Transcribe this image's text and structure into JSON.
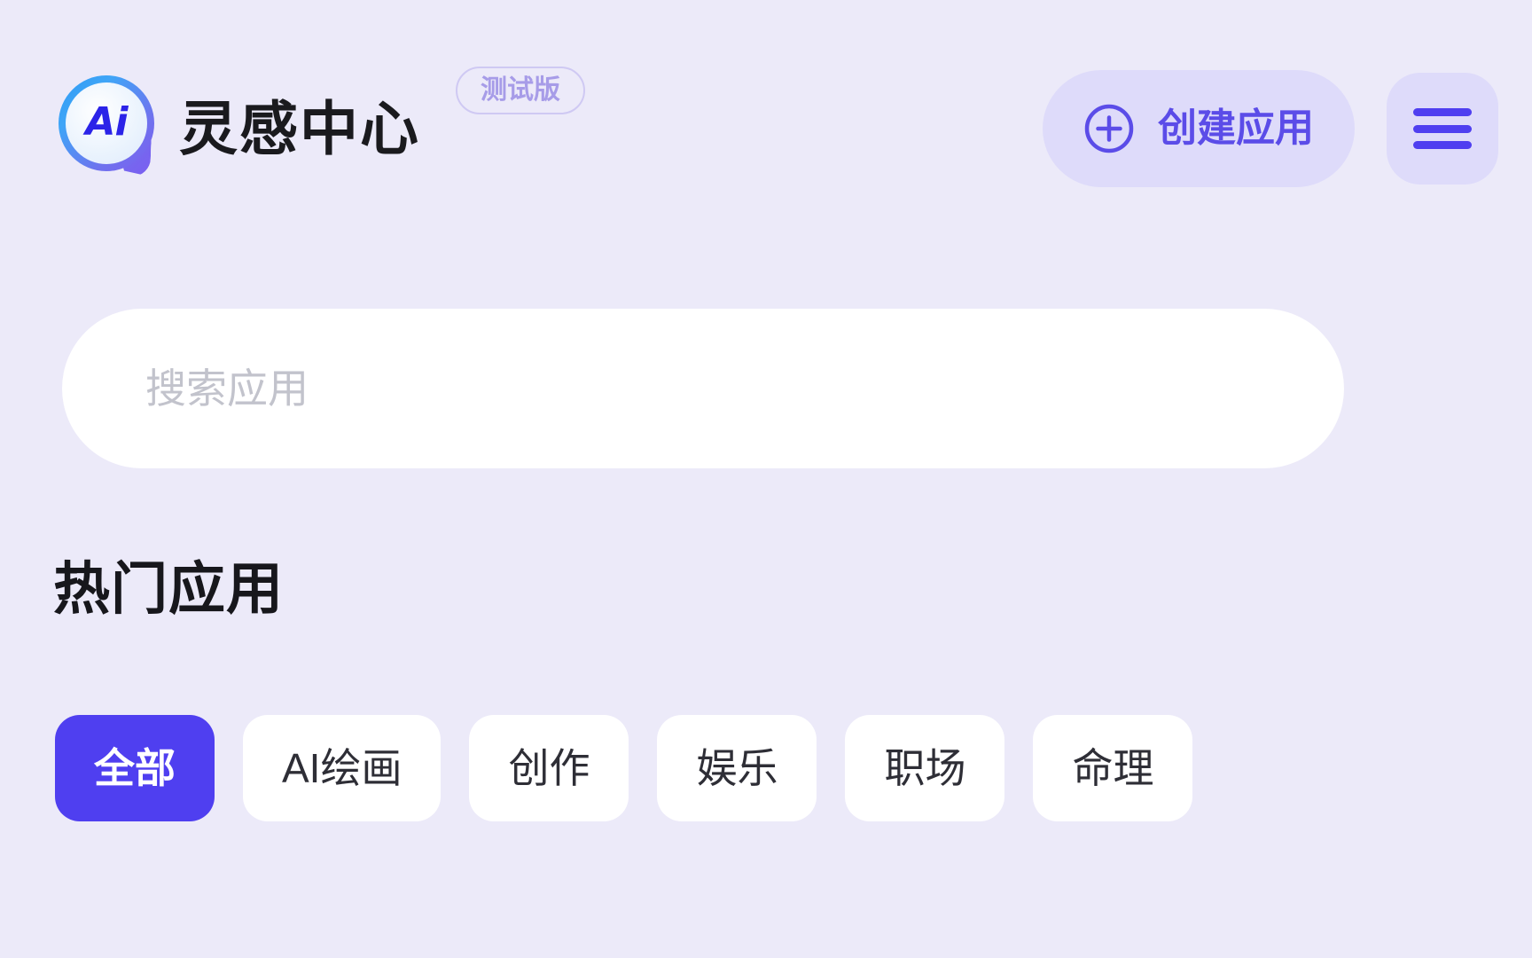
{
  "app": {
    "background_color": "#eceaf9",
    "accent_color": "#4f3ff0",
    "accent_soft_color": "#dedbfa"
  },
  "header": {
    "logo_text": "Ai",
    "title": "灵感中心",
    "badge": "测试版",
    "create_button": {
      "label": "创建应用",
      "icon": "plus-circle-icon"
    },
    "menu_button": {
      "icon": "hamburger-menu-icon"
    }
  },
  "search": {
    "placeholder": "搜索应用",
    "value": ""
  },
  "main": {
    "section_title": "热门应用",
    "categories": [
      {
        "label": "全部",
        "active": true
      },
      {
        "label": "AI绘画",
        "active": false
      },
      {
        "label": "创作",
        "active": false
      },
      {
        "label": "娱乐",
        "active": false
      },
      {
        "label": "职场",
        "active": false
      },
      {
        "label": "命理",
        "active": false
      }
    ]
  }
}
